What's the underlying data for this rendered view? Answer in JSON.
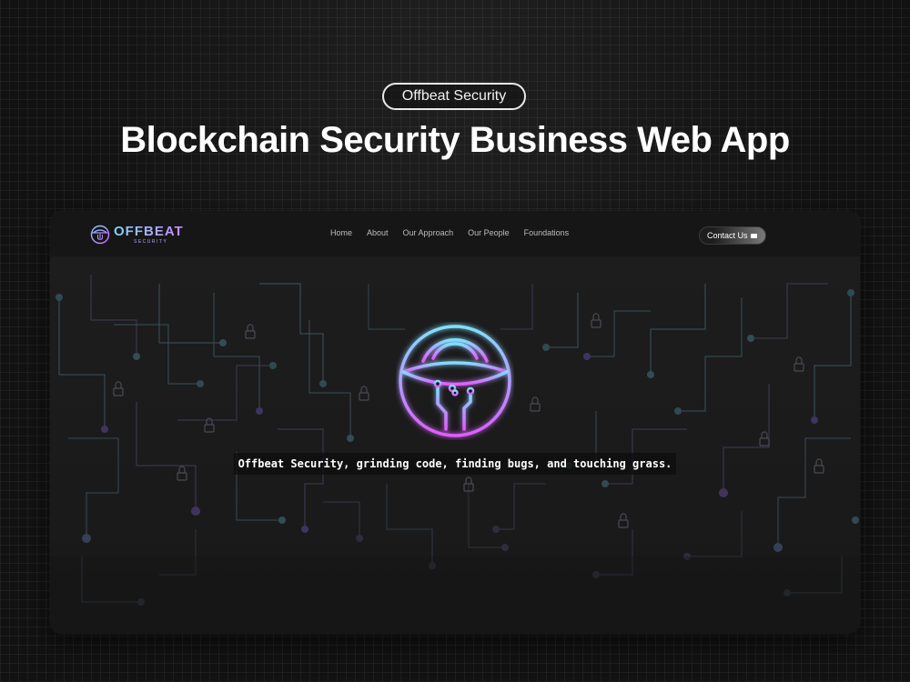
{
  "showcase": {
    "badge": "Offbeat Security",
    "headline": "Blockchain Security Business Web App"
  },
  "site": {
    "logo": {
      "wordmark": "OFFBEAT",
      "subtitle": "SECURITY",
      "icon": "mushroom-circuit-icon"
    },
    "nav": {
      "items": [
        {
          "label": "Home"
        },
        {
          "label": "About"
        },
        {
          "label": "Our Approach"
        },
        {
          "label": "Our People"
        },
        {
          "label": "Foundations"
        }
      ],
      "contact_label": "Contact Us",
      "contact_icon": "chat-bubble-icon"
    },
    "hero": {
      "emblem_icon": "circuit-dome-logo-icon",
      "background_icon": "circuit-lines-with-locks",
      "tagline": "Offbeat Security, grinding code, finding bugs, and touching grass."
    }
  },
  "colors": {
    "page_bg": "#121212",
    "frame_bg": "#1a1a1a",
    "accent_cyan": "#7fd4ff",
    "accent_magenta": "#d36bff",
    "text_primary": "#ffffff",
    "nav_text": "#bdbdbd"
  }
}
